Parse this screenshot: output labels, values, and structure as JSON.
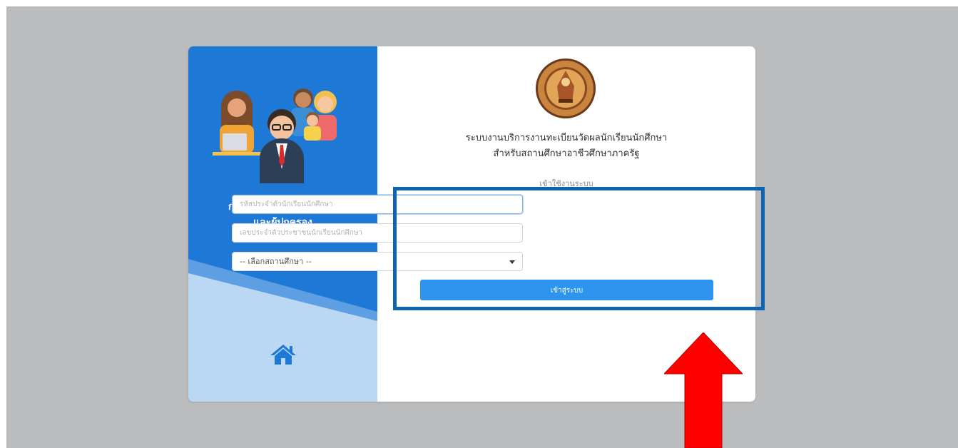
{
  "panel": {
    "group_title_line1": "กลุ่มสิทธิ์นักเรียนนักศึกษา",
    "group_title_line2": "และผู้ปกครอง",
    "home_icon": "home-icon",
    "illustration": "family-illustration"
  },
  "header": {
    "emblem": "vocational-education-commission-emblem",
    "title_line1": "ระบบงานบริการงานทะเบียนวัดผลนักเรียนนักศึกษา",
    "title_line2": "สำหรับสถานศึกษาอาชีวศึกษาภาครัฐ"
  },
  "login": {
    "label": "เข้าใช้งานระบบ",
    "student_id_placeholder": "รหัสประจำตัวนักเรียนนักศึกษา",
    "citizen_id_placeholder": "เลขประจำตัวประชาชนนักเรียนนักศึกษา",
    "school_select_value": "-- เลือกสถานศึกษา --",
    "submit_label": "เข้าสู่ระบบ"
  },
  "colors": {
    "panel_blue": "#1e78d6",
    "button_blue": "#2d95ee",
    "highlight_border": "#0f63b3",
    "arrow_red": "#ff0000",
    "background_gray": "#bbbcbe"
  }
}
